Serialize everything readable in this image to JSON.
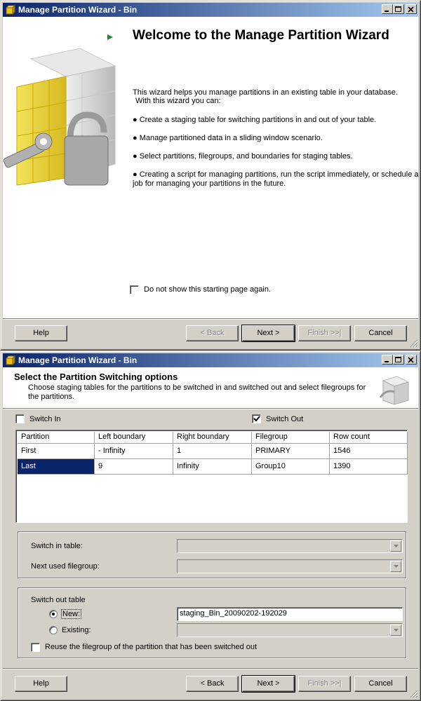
{
  "window1": {
    "title": "Manage Partition Wizard - Bin",
    "heading": "Welcome to the Manage Partition Wizard",
    "intro": "This wizard helps you manage partitions in an existing table in your database.",
    "intro2": "With this wizard you can:",
    "bullets": [
      "● Create a staging table for switching partitions in and out of your table.",
      "● Manage partitioned data in a sliding window scenario.",
      "● Select partitions, filegroups, and boundaries for staging tables.",
      "● Creating a script for managing partitions, run the script immediately, or schedule a",
      "job for managing your partitions in the future."
    ],
    "checkbox_label": "Do not show this starting page again.",
    "checkbox_checked": false,
    "buttons": {
      "help": "Help",
      "back": "< Back",
      "next": "Next >",
      "finish": "Finish >>|",
      "cancel": "Cancel"
    }
  },
  "window2": {
    "title": "Manage Partition Wizard - Bin",
    "heading": "Select the Partition Switching options",
    "subheading": "Choose staging tables for the partitions to be switched in and switched out and select filegroups for",
    "subheading2": "the partitions.",
    "switch_in_label": "Switch In",
    "switch_in_checked": false,
    "switch_out_label": "Switch Out",
    "switch_out_checked": true,
    "table": {
      "columns": [
        "Partition",
        "Left boundary",
        "Right boundary",
        "Filegroup",
        "Row count"
      ],
      "rows": [
        [
          "First",
          "- Infinity",
          "1",
          "PRIMARY",
          "1546"
        ],
        [
          "Last",
          "9",
          "Infinity",
          "Group10",
          "1390"
        ]
      ],
      "selected_row": 1
    },
    "switch_in_table_label": "Switch in table:",
    "next_used_filegroup_label": "Next used filegroup:",
    "switch_out_group_label": "Switch out table",
    "new_label": "New:",
    "new_selected": true,
    "new_value": "staging_Bin_20090202-192029",
    "existing_label": "Existing:",
    "reuse_label": "Reuse the filegroup of the partition that has been switched out",
    "reuse_checked": false,
    "buttons": {
      "help": "Help",
      "back": "< Back",
      "next": "Next >",
      "finish": "Finish >>|",
      "cancel": "Cancel"
    }
  },
  "colors": {
    "title_gradient_start": "#0a246a",
    "title_gradient_end": "#a6caf0",
    "selection": "#0a246a",
    "cube_yellow": "#e8d23a"
  }
}
